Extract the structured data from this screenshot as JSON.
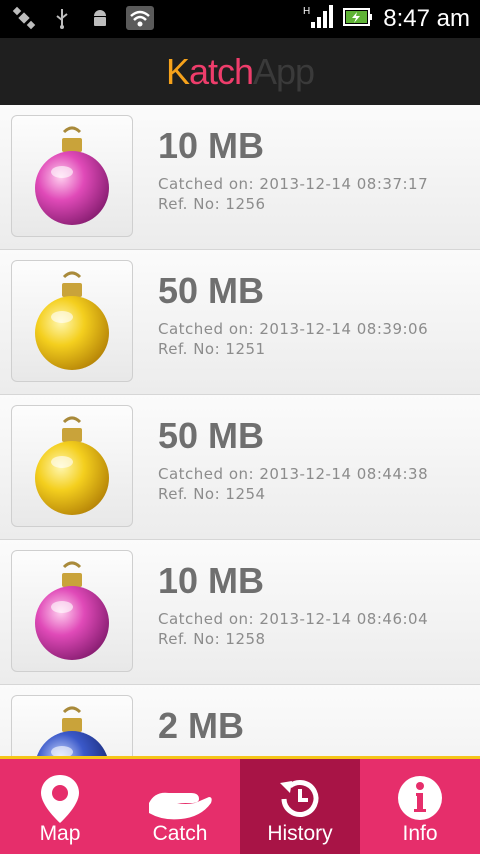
{
  "status_bar": {
    "time": "8:47 am",
    "network": "H",
    "icons": [
      "satellite-icon",
      "usb-icon",
      "android-icon",
      "wifi-icon",
      "signal-icon",
      "battery-icon"
    ]
  },
  "app": {
    "logo_part1": "K",
    "logo_part2": "atch",
    "logo_part3": "App"
  },
  "history": [
    {
      "size": "10 MB",
      "catched": "Catched on: 2013-12-14 08:37:17",
      "ref": "Ref. No: 1256",
      "ornament_color": "pink"
    },
    {
      "size": "50 MB",
      "catched": "Catched on: 2013-12-14 08:39:06",
      "ref": "Ref. No: 1251",
      "ornament_color": "gold"
    },
    {
      "size": "50 MB",
      "catched": "Catched on: 2013-12-14 08:44:38",
      "ref": "Ref. No: 1254",
      "ornament_color": "gold"
    },
    {
      "size": "10 MB",
      "catched": "Catched on: 2013-12-14 08:46:04",
      "ref": "Ref. No: 1258",
      "ornament_color": "pink"
    },
    {
      "size": "2 MB",
      "catched": "",
      "ref": "",
      "ornament_color": "blue"
    }
  ],
  "nav": {
    "map": "Map",
    "catch": "Catch",
    "history": "History",
    "info": "Info",
    "active": "history"
  },
  "colors": {
    "accent": "#e62e6b",
    "accent_active": "#a81446",
    "nav_border": "#f5c518",
    "header_bg": "#1f1f1f"
  }
}
